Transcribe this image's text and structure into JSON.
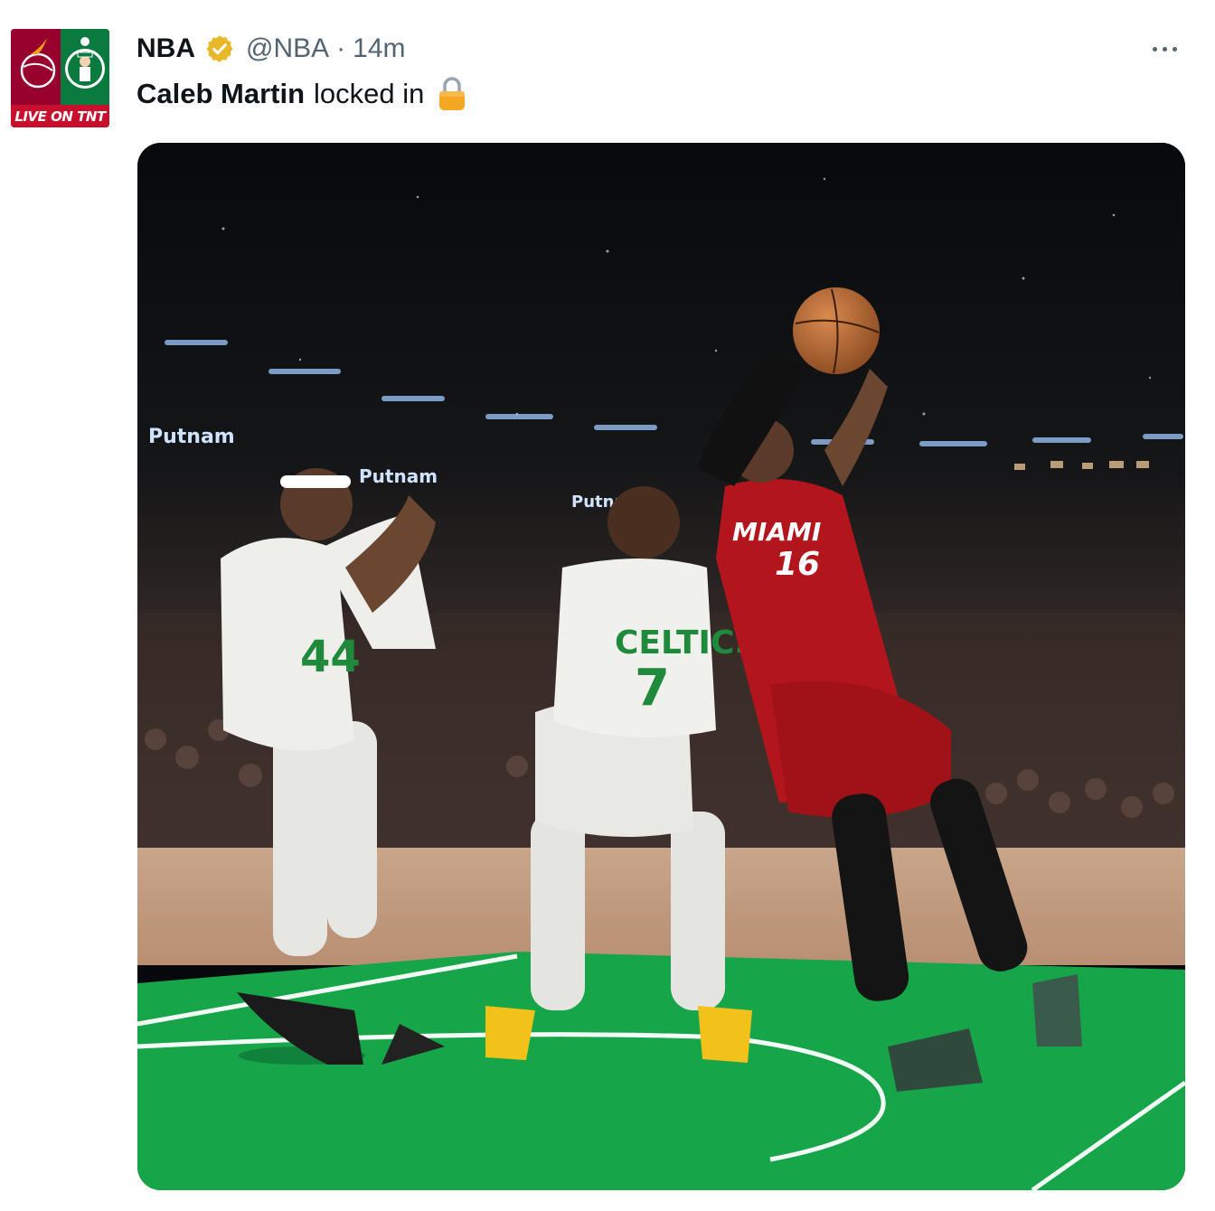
{
  "tweet": {
    "author_name": "NBA",
    "handle": "@NBA",
    "separator": "·",
    "time": "14m",
    "text_bold": "Caleb Martin",
    "text_rest": "locked in",
    "avatar_caption": "LIVE ON TNT"
  },
  "media": {
    "signage": [
      "Putnam",
      "Putnam",
      "Putnam"
    ],
    "jersey_text": {
      "miami": "MIAMI",
      "miami_number": "16",
      "celtics": "CELTICS",
      "celtics_number": "7"
    }
  },
  "icons": {
    "verified": "verified-badge-icon",
    "lock": "lock-emoji-icon",
    "more": "more-options-icon"
  },
  "colors": {
    "verified_gold": "#e8b72a",
    "court_green": "#16a34a",
    "heat_red": "#b3151d",
    "handle_gray": "#536471"
  }
}
